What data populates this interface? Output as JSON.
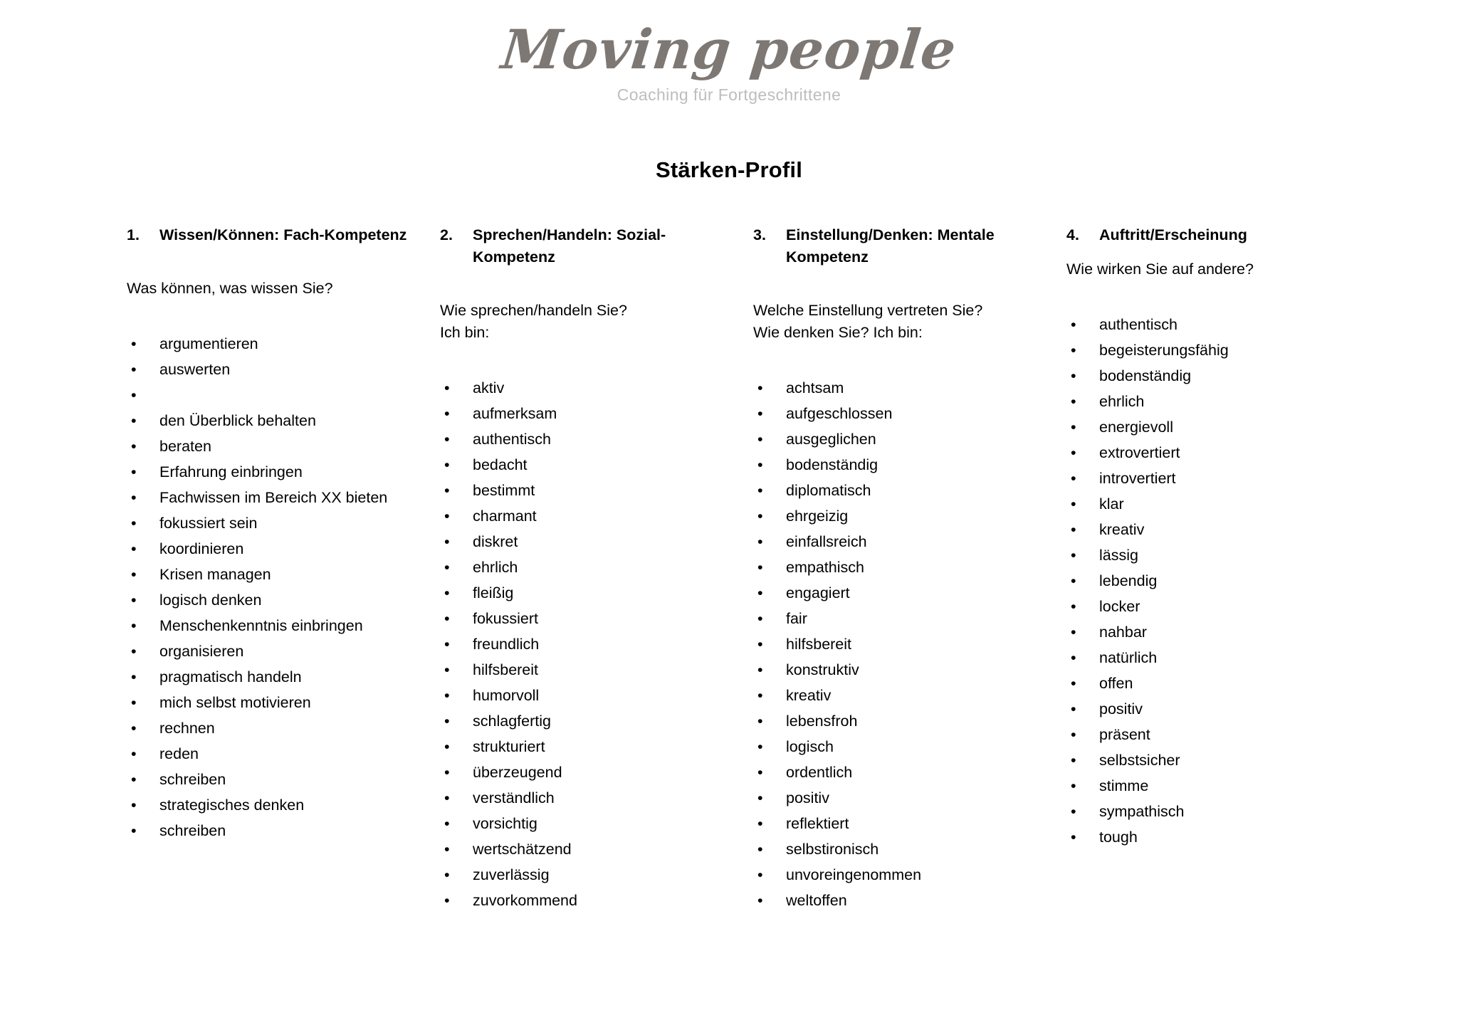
{
  "brand": {
    "wordmark": "Moving people",
    "tagline": "Coaching für Fortgeschrittene",
    "wordmark_color": "#7d7874",
    "tagline_color": "#bdbdbd"
  },
  "document": {
    "title": "Stärken-Profil",
    "background_color": "#ffffff",
    "text_color": "#000000"
  },
  "columns": [
    {
      "number": "1.",
      "heading": "Wissen/Können: Fach-Kompetenz",
      "question": "Was können, was wissen Sie?",
      "question_gap": "tall",
      "bullet_glyph": "•",
      "items": [
        "argumentieren",
        "auswerten",
        "",
        "den Überblick behalten",
        "beraten",
        "Erfahrung einbringen",
        "Fachwissen im Bereich XX bieten",
        "fokussiert sein",
        "koordinieren",
        "Krisen managen",
        "logisch denken",
        "Menschenkenntnis einbringen",
        "organisieren",
        "pragmatisch handeln",
        "mich selbst motivieren",
        "rechnen",
        "reden",
        "schreiben",
        "strategisches denken",
        "schreiben"
      ]
    },
    {
      "number": "2.",
      "heading": "Sprechen/Handeln: Sozial-Kompetenz",
      "question": "Wie sprechen/handeln Sie?\nIch bin:",
      "question_gap": "tall",
      "bullet_glyph": "•",
      "items": [
        "aktiv",
        "aufmerksam",
        "authentisch",
        "bedacht",
        "bestimmt",
        "charmant",
        "diskret",
        "ehrlich",
        "fleißig",
        "fokussiert",
        "freundlich",
        "hilfsbereit",
        "humorvoll",
        "schlagfertig",
        "strukturiert",
        "überzeugend",
        "verständlich",
        "vorsichtig",
        "wertschätzend",
        "zuverlässig",
        "zuvorkommend"
      ]
    },
    {
      "number": "3.",
      "heading": "Einstellung/Denken: Mentale Kompetenz",
      "question": "Welche Einstellung vertreten Sie?\nWie denken Sie? Ich bin:",
      "question_gap": "tall",
      "bullet_glyph": "•",
      "items": [
        "achtsam",
        "aufgeschlossen",
        "ausgeglichen",
        "bodenständig",
        "diplomatisch",
        "ehrgeizig",
        "einfallsreich",
        "empathisch",
        "engagiert",
        "fair",
        "hilfsbereit",
        "konstruktiv",
        "kreativ",
        "lebensfroh",
        "logisch",
        "ordentlich",
        "positiv",
        "reflektiert",
        "selbstironisch",
        "unvoreingenommen",
        "weltoffen"
      ]
    },
    {
      "number": "4.",
      "heading": "Auftritt/Erscheinung",
      "question": "Wie wirken Sie auf andere?",
      "question_gap": "short",
      "bullet_glyph": "•",
      "items": [
        "authentisch",
        "begeisterungsfähig",
        "bodenständig",
        "ehrlich",
        "energievoll",
        "extrovertiert",
        "introvertiert",
        "klar",
        "kreativ",
        "lässig",
        "lebendig",
        "locker",
        "nahbar",
        "natürlich",
        "offen",
        "positiv",
        "präsent",
        "selbstsicher",
        "stimme",
        "sympathisch",
        "tough"
      ]
    }
  ]
}
